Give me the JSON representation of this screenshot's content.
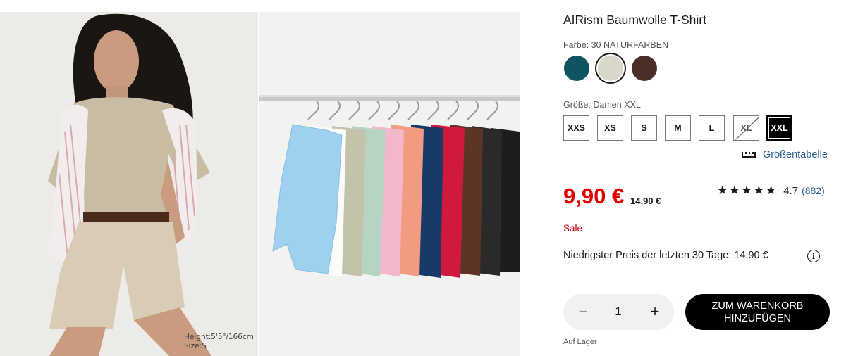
{
  "gallery": {
    "model_caption_height": "Height:5'5\"/166cm",
    "model_caption_size": "Size:S"
  },
  "product": {
    "title": "AIRism Baumwolle T-Shirt",
    "color_label": "Farbe: 30 NATURFARBEN",
    "colors": [
      {
        "name": "teal",
        "hex": "#0e5462",
        "selected": false
      },
      {
        "name": "natural",
        "hex": "#dad6c9",
        "selected": true
      },
      {
        "name": "brown",
        "hex": "#4a2f28",
        "selected": false
      }
    ],
    "size_label": "Größe: Damen XXL",
    "sizes": [
      {
        "label": "XXS",
        "state": "available"
      },
      {
        "label": "XS",
        "state": "available"
      },
      {
        "label": "S",
        "state": "available"
      },
      {
        "label": "M",
        "state": "available"
      },
      {
        "label": "L",
        "state": "available"
      },
      {
        "label": "XL",
        "state": "unavailable"
      },
      {
        "label": "XXL",
        "state": "selected"
      }
    ],
    "size_chart_link": "Größentabelle",
    "price": "9,90 €",
    "old_price": "14,90 €",
    "rating_value": "4.7",
    "rating_count": "(882)",
    "rating_fraction": 0.94,
    "sale_label": "Sale",
    "lowest_price_note": "Niedrigster Preis der letzten 30 Tage: 14,90 €",
    "info_icon_glyph": "i",
    "quantity": "1",
    "quantity_minus": "−",
    "quantity_plus": "+",
    "cart_button_line1": "ZUM WARENKORB",
    "cart_button_line2": "HINZUFÜGEN",
    "stock_status": "Auf Lager"
  },
  "colors": {
    "sale_red": "#e00000",
    "link_blue": "#2a5f8f",
    "button_black": "#000000"
  },
  "icons": [
    "ruler-icon",
    "info-icon",
    "star-icon",
    "minus-icon",
    "plus-icon"
  ]
}
